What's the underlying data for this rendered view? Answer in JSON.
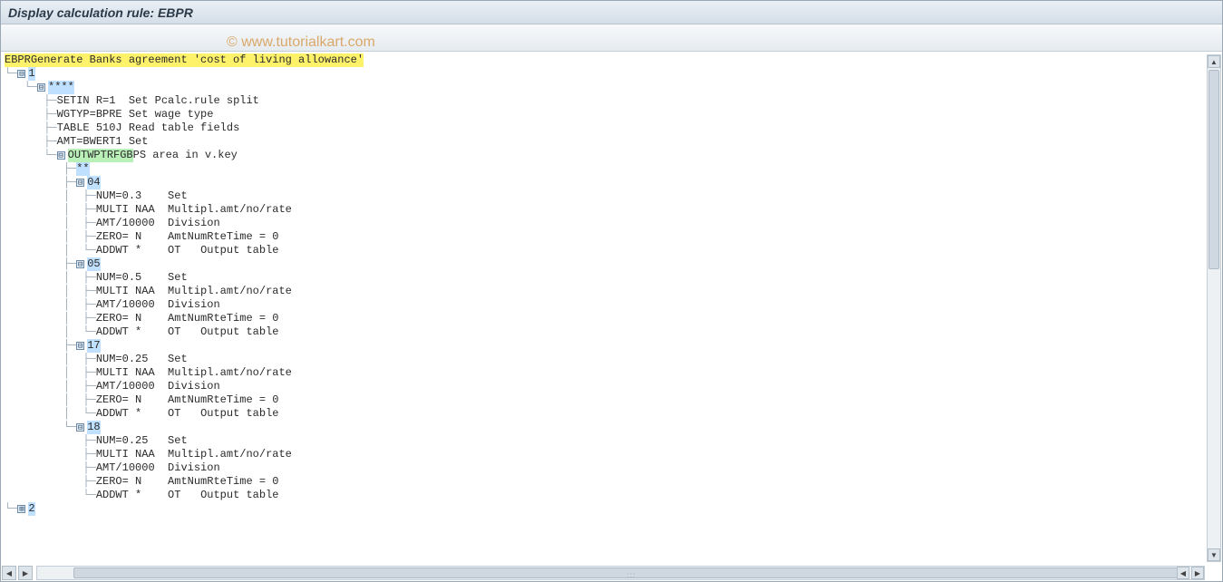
{
  "window": {
    "title": "Display calculation rule: EBPR"
  },
  "watermark": "© www.tutorialkart.com",
  "root": {
    "code": "EBPR",
    "desc": "Generate Banks agreement 'cost of living allowance'"
  },
  "node1": {
    "label": "1"
  },
  "stars": {
    "label": "****"
  },
  "commands_top": [
    {
      "op": "SETIN R=1",
      "desc": "Set Pcalc.rule split"
    },
    {
      "op": "WGTYP=BPRE",
      "desc": "Set wage type"
    },
    {
      "op": "TABLE 510J",
      "desc": "Read table fields"
    },
    {
      "op": "AMT=BWERT1",
      "desc": "Set"
    }
  ],
  "outwp": {
    "code": "OUTWPTRFGB",
    "desc": "PS area in v.key"
  },
  "star2": {
    "label": "**"
  },
  "groups": [
    {
      "key": "04",
      "rows": [
        {
          "op": "NUM=0.3",
          "desc": "Set"
        },
        {
          "op": "MULTI NAA",
          "desc": "Multipl.amt/no/rate"
        },
        {
          "op": "AMT/10000",
          "desc": "Division"
        },
        {
          "op": "ZERO= N",
          "desc": "AmtNumRteTime = 0"
        },
        {
          "op": "ADDWT *",
          "mid": "OT",
          "desc": "Output table"
        }
      ]
    },
    {
      "key": "05",
      "rows": [
        {
          "op": "NUM=0.5",
          "desc": "Set"
        },
        {
          "op": "MULTI NAA",
          "desc": "Multipl.amt/no/rate"
        },
        {
          "op": "AMT/10000",
          "desc": "Division"
        },
        {
          "op": "ZERO= N",
          "desc": "AmtNumRteTime = 0"
        },
        {
          "op": "ADDWT *",
          "mid": "OT",
          "desc": "Output table"
        }
      ]
    },
    {
      "key": "17",
      "rows": [
        {
          "op": "NUM=0.25",
          "desc": "Set"
        },
        {
          "op": "MULTI NAA",
          "desc": "Multipl.amt/no/rate"
        },
        {
          "op": "AMT/10000",
          "desc": "Division"
        },
        {
          "op": "ZERO= N",
          "desc": "AmtNumRteTime = 0"
        },
        {
          "op": "ADDWT *",
          "mid": "OT",
          "desc": "Output table"
        }
      ]
    },
    {
      "key": "18",
      "rows": [
        {
          "op": "NUM=0.25",
          "desc": "Set"
        },
        {
          "op": "MULTI NAA",
          "desc": "Multipl.amt/no/rate"
        },
        {
          "op": "AMT/10000",
          "desc": "Division"
        },
        {
          "op": "ZERO= N",
          "desc": "AmtNumRteTime = 0"
        },
        {
          "op": "ADDWT *",
          "mid": "OT",
          "desc": "Output table"
        }
      ]
    }
  ],
  "node2": {
    "label": "2"
  },
  "glyphs": {
    "collapse": "⊟",
    "expand": "⊞",
    "up": "▲",
    "down": "▼",
    "left": "◀",
    "right": "▶"
  }
}
